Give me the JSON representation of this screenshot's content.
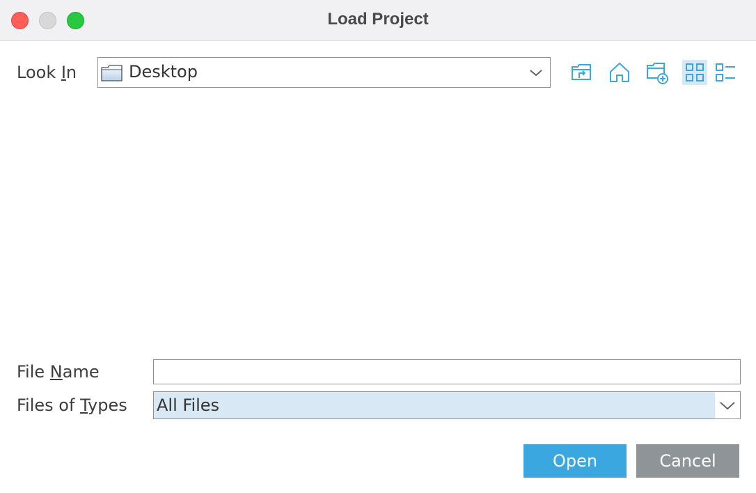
{
  "window": {
    "title": "Load Project"
  },
  "look_in": {
    "label_prefix": "Look ",
    "label_mnemonic": "I",
    "label_suffix": "n",
    "value": "Desktop",
    "value_icon": "folder-icon"
  },
  "toolbar": {
    "icons": [
      "up-folder-icon",
      "home-icon",
      "new-folder-icon",
      "grid-view-icon",
      "list-view-icon"
    ],
    "selected": "grid-view-icon",
    "accent_color": "#3aa7e0"
  },
  "file_name": {
    "label_prefix": "File ",
    "label_mnemonic": "N",
    "label_suffix": "ame",
    "value": ""
  },
  "file_types": {
    "label_prefix": "Files of ",
    "label_mnemonic": "T",
    "label_suffix": "ypes",
    "value": "All Files"
  },
  "buttons": {
    "open": "Open",
    "cancel": "Cancel"
  },
  "colors": {
    "close": "#ff5f57",
    "minimize": "#d8d8d8",
    "zoom": "#28c840",
    "open_button": "#3aa7e0",
    "cancel_button": "#8f9499",
    "selection": "#d6e7f5"
  }
}
